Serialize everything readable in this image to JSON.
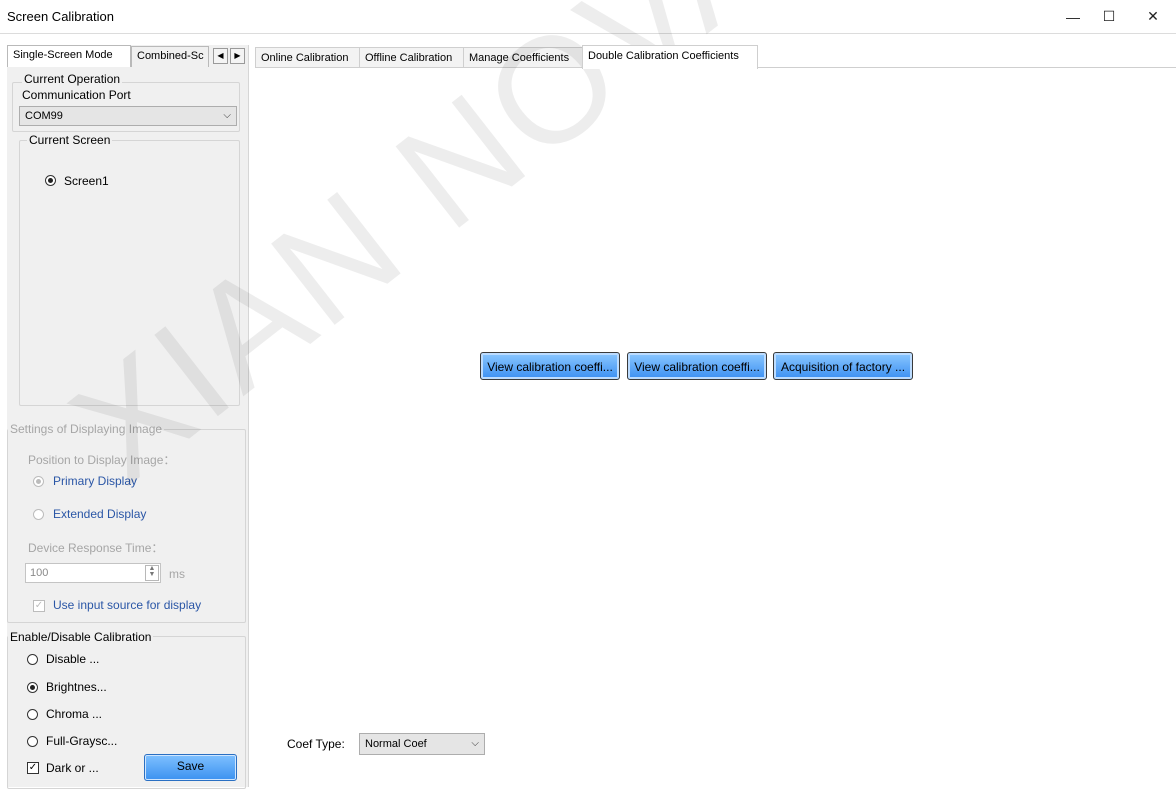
{
  "window": {
    "title": "Screen Calibration",
    "minimize_icon": "—",
    "maximize_icon": "☐",
    "close_icon": "✕"
  },
  "left_tabs": [
    {
      "label": "Single-Screen Mode",
      "active": true
    },
    {
      "label": "Combined-Sc",
      "active": false
    }
  ],
  "current_operation": {
    "legend": "Current Operation",
    "port_label": "Communication Port",
    "port_value": "COM99"
  },
  "current_screen": {
    "legend": "Current Screen",
    "screens": [
      {
        "label": "Screen1",
        "selected": true
      }
    ]
  },
  "display_settings": {
    "legend": "Settings of Displaying Image",
    "position_label": "Position to Display Image：",
    "options": [
      {
        "label": "Primary Display",
        "selected": true
      },
      {
        "label": "Extended Display",
        "selected": false
      }
    ],
    "response_label": "Device Response Time：",
    "response_value": "100",
    "response_unit": "ms",
    "use_input_label": "Use input source for display",
    "use_input_checked": true
  },
  "calibration": {
    "legend": "Enable/Disable Calibration",
    "options": [
      {
        "label": "Disable ...",
        "selected": false
      },
      {
        "label": "Brightnes...",
        "selected": true
      },
      {
        "label": "Chroma ...",
        "selected": false
      },
      {
        "label": "Full-Graysc...",
        "selected": false
      }
    ],
    "dark_label": "Dark or ...",
    "dark_checked": true,
    "save_label": "Save"
  },
  "main_tabs": [
    {
      "label": "Online Calibration",
      "active": false
    },
    {
      "label": "Offline Calibration",
      "active": false
    },
    {
      "label": "Manage Coefficients",
      "active": false
    },
    {
      "label": "Double Calibration Coefficients",
      "active": true
    }
  ],
  "actions": [
    {
      "label": "View calibration coeffi..."
    },
    {
      "label": "View calibration coeffi..."
    },
    {
      "label": "Acquisition of factory ..."
    }
  ],
  "coef_type": {
    "label": "Coef Type:",
    "value": "Normal Coef"
  },
  "watermark": "XIAN NOVASTAR TECH CO.,"
}
